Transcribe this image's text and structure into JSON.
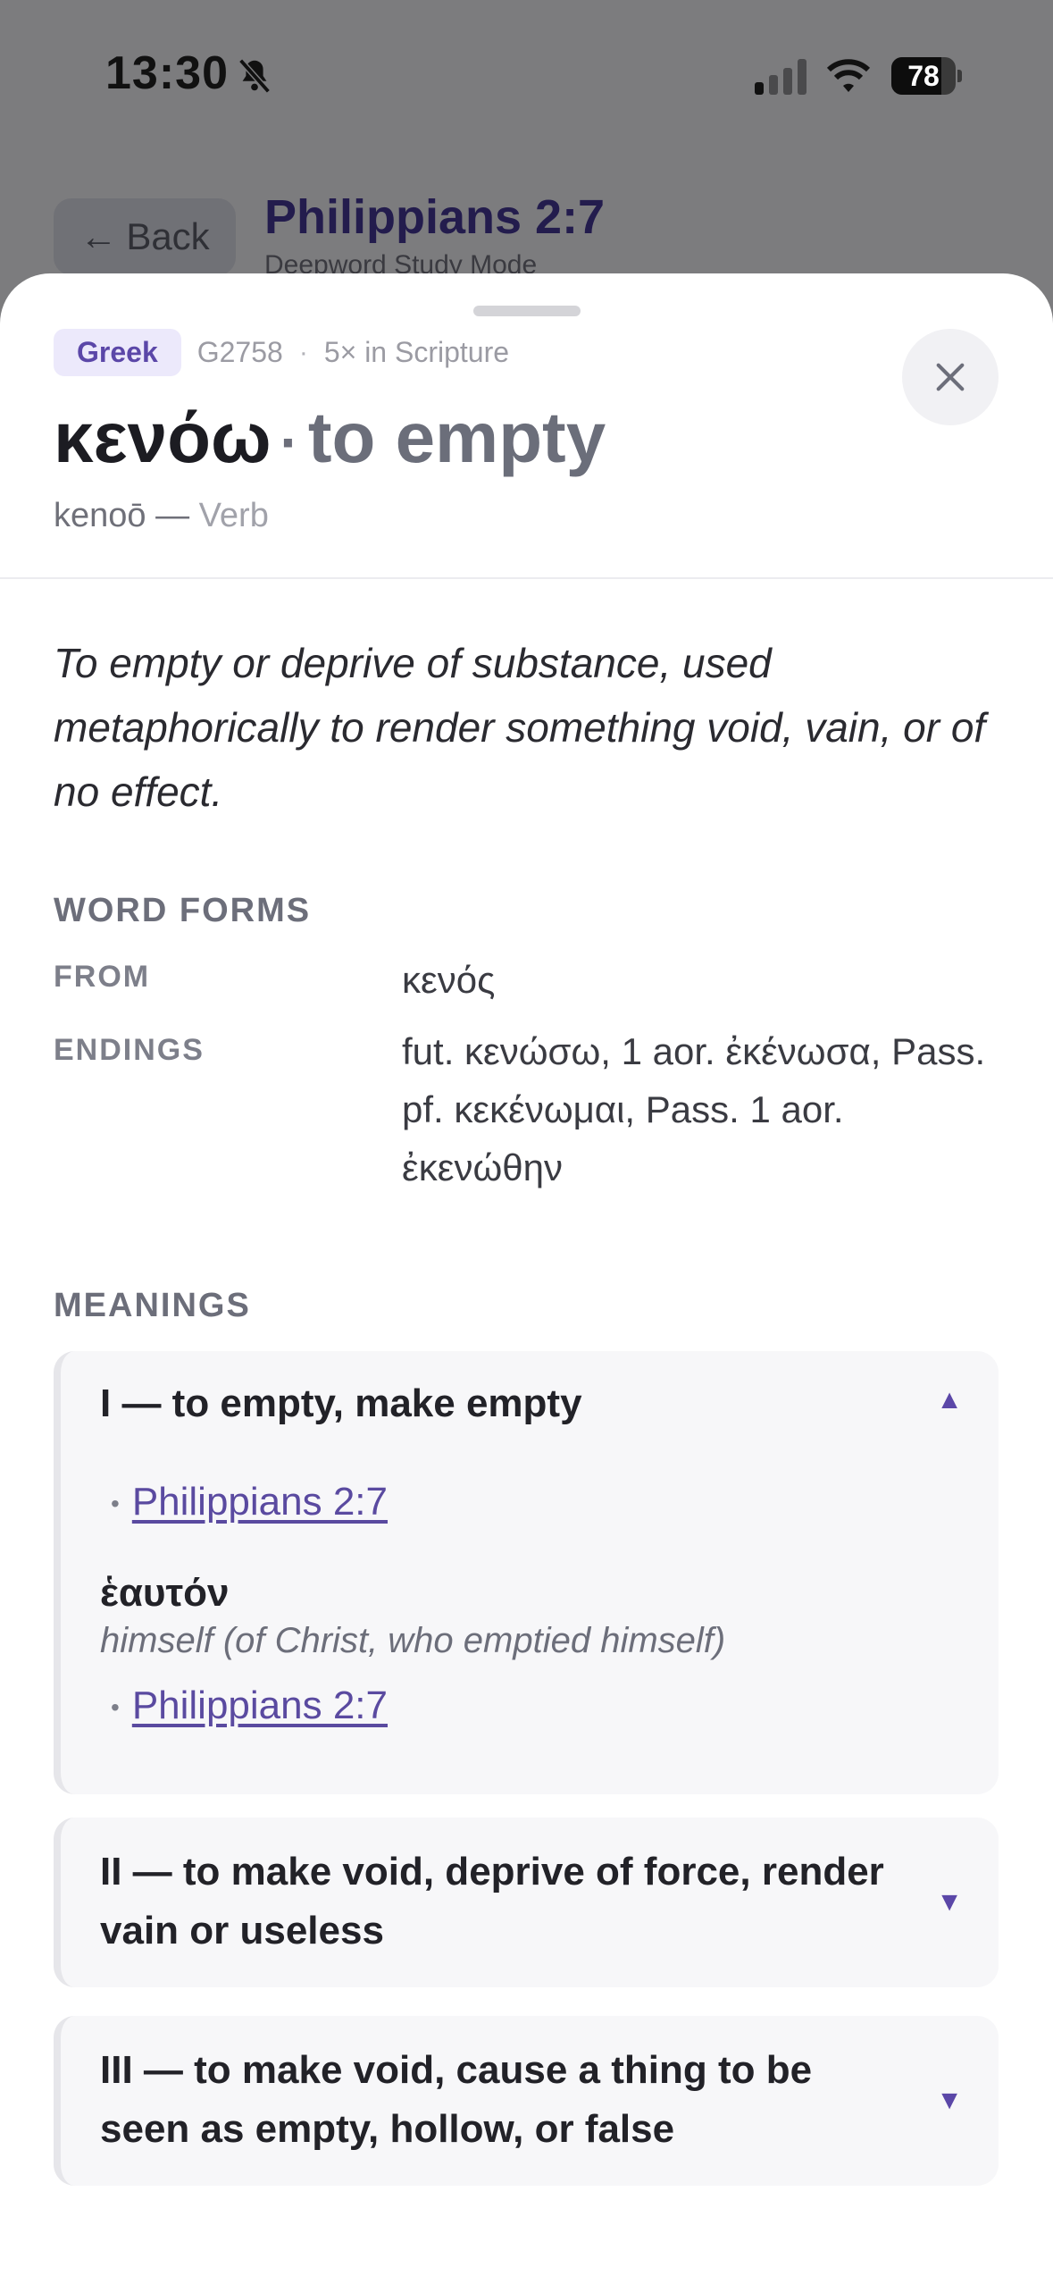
{
  "status_bar": {
    "time": "13:30",
    "battery_level": "78",
    "battery_fraction": 0.78,
    "icons": [
      "bell-slash-icon",
      "cellular-signal-icon",
      "wifi-icon",
      "battery-icon"
    ]
  },
  "background_page": {
    "back_label": "Back",
    "title": "Philippians 2:7",
    "subtitle": "Deepword Study Mode"
  },
  "sheet": {
    "language": "Greek",
    "strongs": "G2758",
    "meta_separator": "·",
    "occurrences": "5× in Scripture",
    "headword": "κενόω",
    "head_separator": "·",
    "gloss": "to empty",
    "transliteration": "kenoō",
    "translit_separator": "—",
    "part_of_speech": "Verb",
    "definition": "To empty or deprive of substance, used metaphorically to render something void, vain, or of no effect.",
    "word_forms": {
      "heading": "WORD FORMS",
      "from_label": "FROM",
      "from_value": "κενός",
      "endings_label": "ENDINGS",
      "endings_value": "fut. κενώσω, 1 aor. ἐκένωσα, Pass. pf. κεκένωμαι, Pass. 1 aor. ἐκενώθην"
    },
    "meanings_heading": "MEANINGS",
    "meanings": [
      {
        "title": "I — to empty, make empty",
        "chevron": "▲",
        "reference": "Philippians 2:7",
        "sub_lemma": "ἑαυτόν",
        "sub_gloss": "himself (of Christ, who emptied himself)",
        "sub_reference": "Philippians 2:7"
      },
      {
        "title": "II — to make void, deprive of force, render vain or useless",
        "chevron": "▼"
      },
      {
        "title": "III — to make void, cause a thing to be seen as empty, hollow, or false",
        "chevron": "▼"
      }
    ],
    "bullet": "•"
  },
  "colors": {
    "accent": "#5b47a8",
    "badge_bg": "#ece9fb",
    "overlay": "#7c7c7e"
  }
}
